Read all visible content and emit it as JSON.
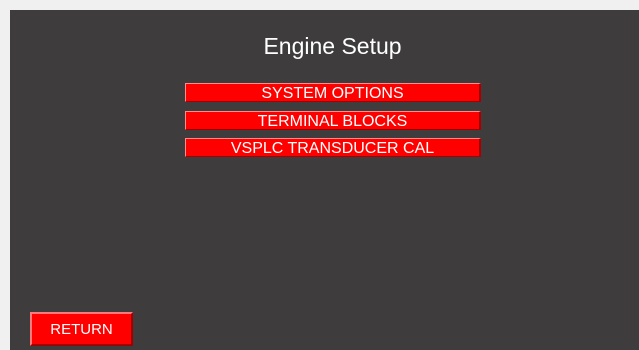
{
  "screen": {
    "title": "Engine Setup"
  },
  "menu": {
    "items": [
      {
        "label": "SYSTEM OPTIONS"
      },
      {
        "label": "TERMINAL BLOCKS"
      },
      {
        "label": "VSPLC TRANSDUCER CAL"
      }
    ]
  },
  "footer": {
    "return_label": "RETURN"
  },
  "colors": {
    "screen_background": "#3e3c3d",
    "button": "#ff0000",
    "text": "#ffffff"
  }
}
